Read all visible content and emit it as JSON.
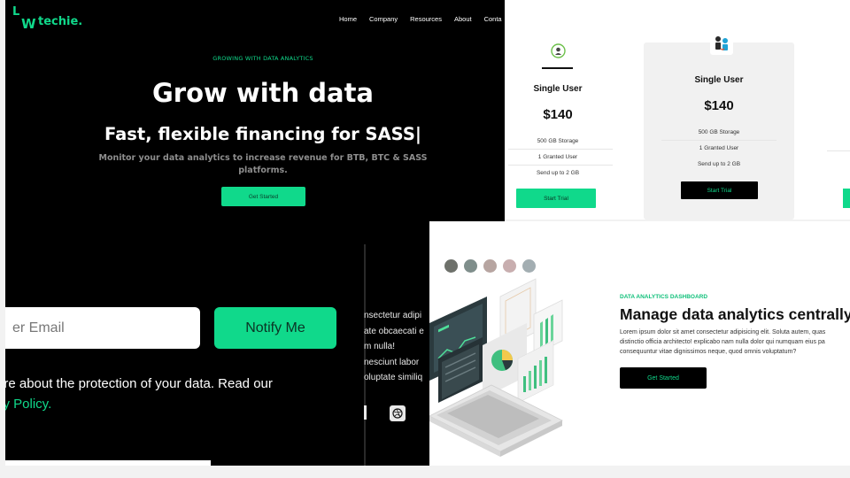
{
  "brand": {
    "logo_l": "L",
    "logo_w": "W",
    "logo_text": "techie."
  },
  "nav": [
    "Home",
    "Company",
    "Resources",
    "About",
    "Conta"
  ],
  "hero": {
    "eyebrow": "GROWING WITH DATA ANALYTICS",
    "title": "Grow with data",
    "subtitle": "Fast, flexible financing for SASS|",
    "description": "Monitor your data analytics to increase revenue for BTB, BTC & SASS platforms.",
    "cta": "Get Started"
  },
  "newsletter": {
    "email_placeholder": "er Email",
    "notify_label": "Notify Me",
    "privacy_line1": "are about the protection of your data. Read our",
    "privacy_link": "cy Policy."
  },
  "lorem_column": [
    "nsectetur adipi",
    "ate obcaecati e",
    "m nulla!",
    "nesciunt labor",
    "oluptate similiq"
  ],
  "pricing": {
    "plans": [
      {
        "name": "Single User",
        "price": "$140",
        "features": [
          "500 GB Storage",
          "1 Granted User",
          "Send up to 2 GB"
        ],
        "button": "Start Trial"
      },
      {
        "name": "Single User",
        "price": "$140",
        "features": [
          "500 GB Storage",
          "1 Granted User",
          "Send up to 2 GB"
        ],
        "button": "Start Trial"
      }
    ]
  },
  "feature": {
    "eyebrow": "DATA ANALYTICS DASHBOARD",
    "title": "Manage data analytics centrally",
    "description": [
      "Lorem ipsum dolor sit amet consectetur adipisicing elit. Soluta autem, quas",
      "distinctio officia architecto! explicabo nam nulla dolor qui numquam eius pa",
      "consequuntur vitae dignissimos neque, quod omnis voluptatum?"
    ],
    "cta": "Get Started",
    "swatch_colors": [
      "#6e716b",
      "#7f8e8b",
      "#b7a5a1",
      "#c8aeaf",
      "#a3aeb2"
    ]
  },
  "colors": {
    "accent": "#10d98b",
    "dark": "#000000"
  }
}
